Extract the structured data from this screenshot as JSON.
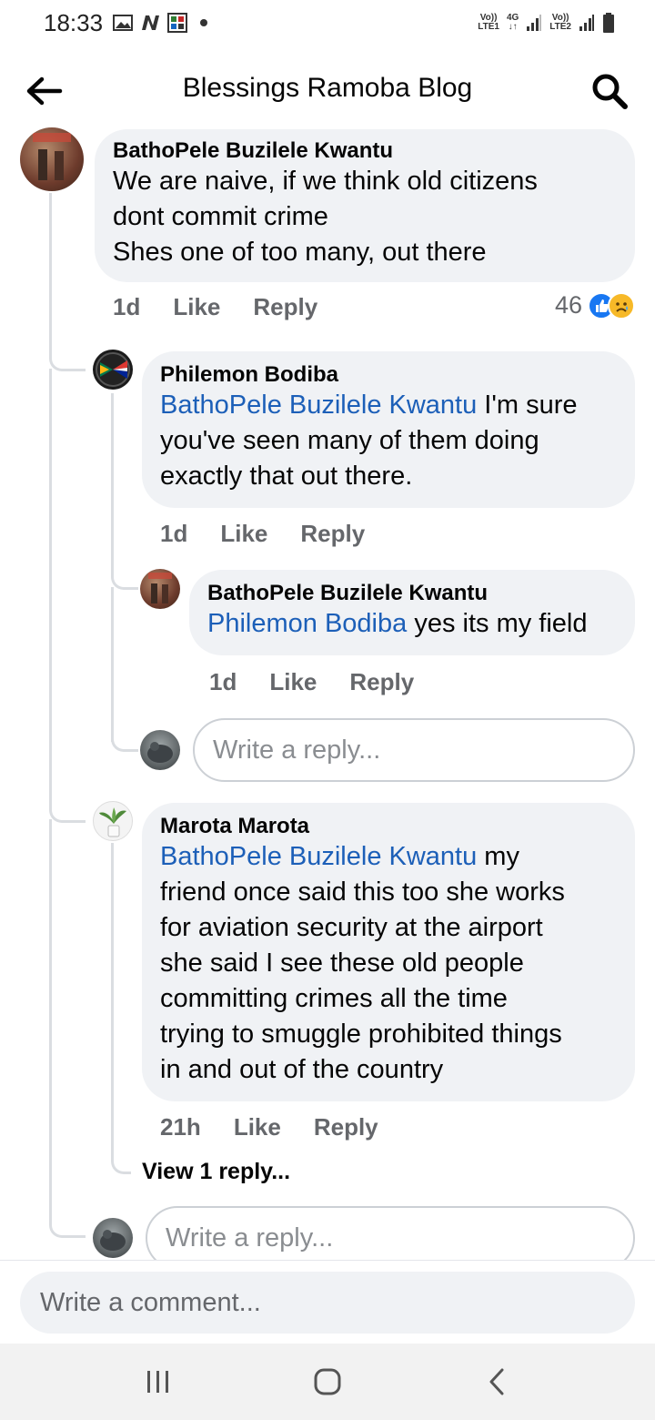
{
  "status_bar": {
    "time": "18:33",
    "sim1_top": "Vo))",
    "sim1_bottom": "LTE1",
    "network": "4G",
    "sim2_top": "Vo))",
    "sim2_bottom": "LTE2"
  },
  "header": {
    "title": "Blessings Ramoba Blog"
  },
  "comments": {
    "c1": {
      "author": "BathoPele Buzilele Kwantu",
      "text_lines": [
        "We are naive, if we think old citizens",
        "dont commit crime",
        "Shes one of too many, out there"
      ],
      "time": "1d",
      "like": "Like",
      "reply": "Reply",
      "reaction_count": "46"
    },
    "r1": {
      "author": "Philemon Bodiba",
      "mention": "BathoPele Buzilele Kwantu",
      "line1_rest": " I'm sure",
      "line2": "you've seen many of them doing",
      "line3": "exactly that out there.",
      "time": "1d",
      "like": "Like",
      "reply": "Reply"
    },
    "r1a": {
      "author": "BathoPele Buzilele Kwantu",
      "mention": "Philemon Bodiba",
      "rest": " yes its my field",
      "time": "1d",
      "like": "Like",
      "reply": "Reply"
    },
    "r2": {
      "author": "Marota Marota",
      "mention": "BathoPele Buzilele Kwantu",
      "line1_rest": " my",
      "lines": [
        "friend once said this too she works",
        "for aviation security at the airport",
        "she said I see these old people",
        "committing crimes all the time",
        "trying to smuggle prohibited things",
        "in and out of the country"
      ],
      "time": "21h",
      "like": "Like",
      "reply": "Reply",
      "view_replies": "View 1 reply..."
    }
  },
  "inputs": {
    "reply_placeholder": "Write a reply...",
    "comment_placeholder": "Write a comment..."
  },
  "colors": {
    "mention": "#1c5fb8",
    "like_blue": "#1877f2",
    "bubble": "#f0f2f5"
  }
}
